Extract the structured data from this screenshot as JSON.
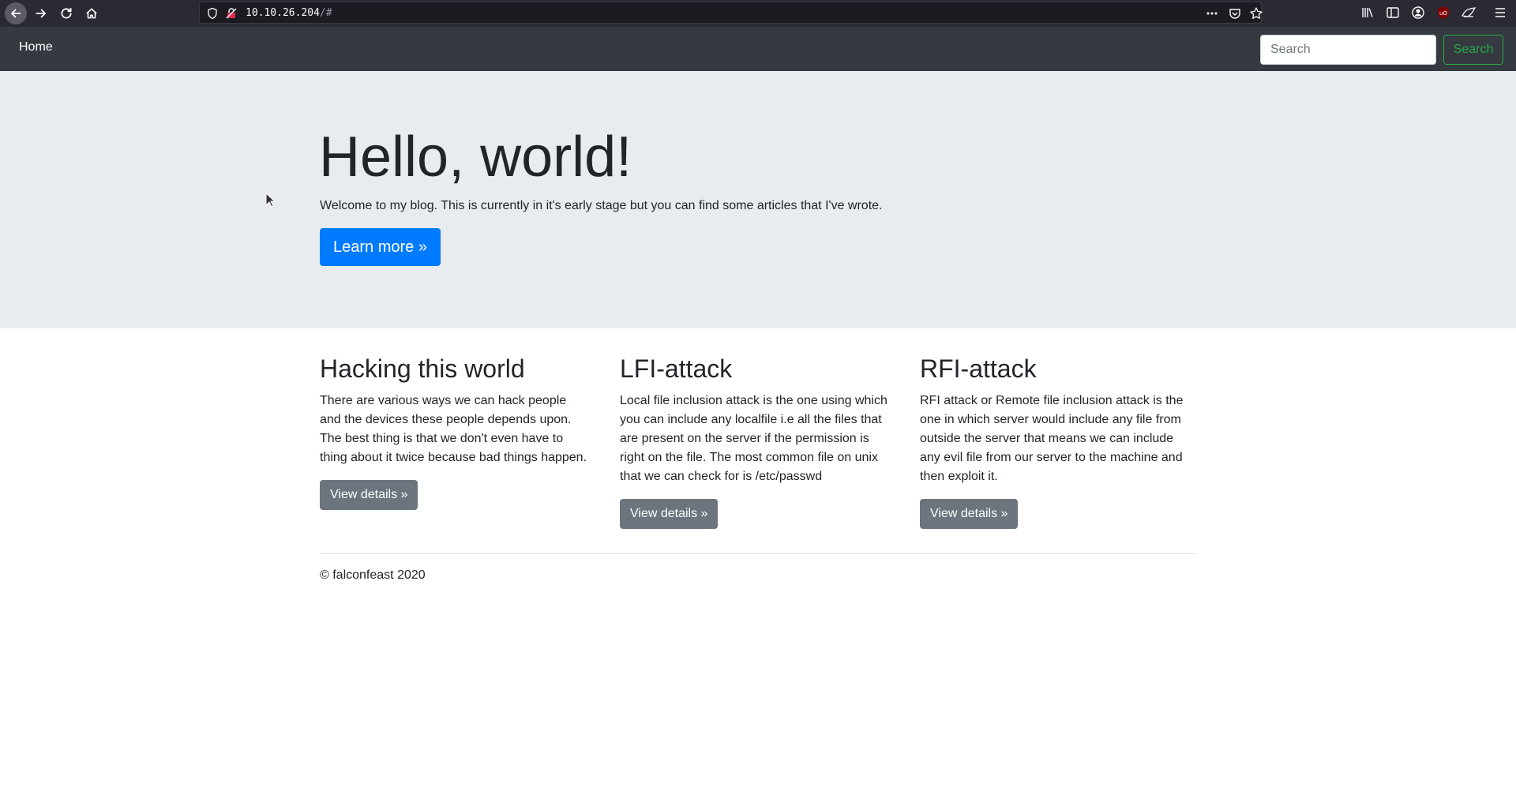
{
  "browser": {
    "url_host": "10.10.26.204",
    "url_path": "/#",
    "icons": [
      "back-icon",
      "forward-icon",
      "reload-icon",
      "home-icon",
      "shield-icon",
      "insecure-lock-icon",
      "more-icon",
      "pocket-icon",
      "bookmark-star-icon",
      "library-icon",
      "sidebar-icon",
      "account-icon",
      "ublock-icon",
      "extension-icon",
      "menu-icon"
    ]
  },
  "navbar": {
    "brand": "Home",
    "search_placeholder": "Search",
    "search_button": "Search"
  },
  "hero": {
    "title": "Hello, world!",
    "lead": "Welcome to my blog. This is currently in it's early stage but you can find some articles that I've wrote.",
    "button": "Learn more »",
    "button_color": "#007bff"
  },
  "articles": [
    {
      "title": "Hacking this world",
      "body": "There are various ways we can hack people and the devices these people depends upon. The best thing is that we don't even have to thing about it twice because bad things happen.",
      "button": "View details »"
    },
    {
      "title": "LFI-attack",
      "body": "Local file inclusion attack is the one using which you can include any localfile i.e all the files that are present on the server if the permission is right on the file. The most common file on unix that we can check for is /etc/passwd",
      "button": "View details »"
    },
    {
      "title": "RFI-attack",
      "body": "RFI attack or Remote file inclusion attack is the one in which server would include any file from outside the server that means we can include any evil file from our server to the machine and then exploit it.",
      "button": "View details »"
    }
  ],
  "footer": {
    "text": "© falconfeast 2020"
  },
  "colors": {
    "navbar_bg": "#343a40",
    "jumbotron_bg": "#e9ecef",
    "search_green": "#28a745",
    "secondary_btn": "#6c757d"
  }
}
